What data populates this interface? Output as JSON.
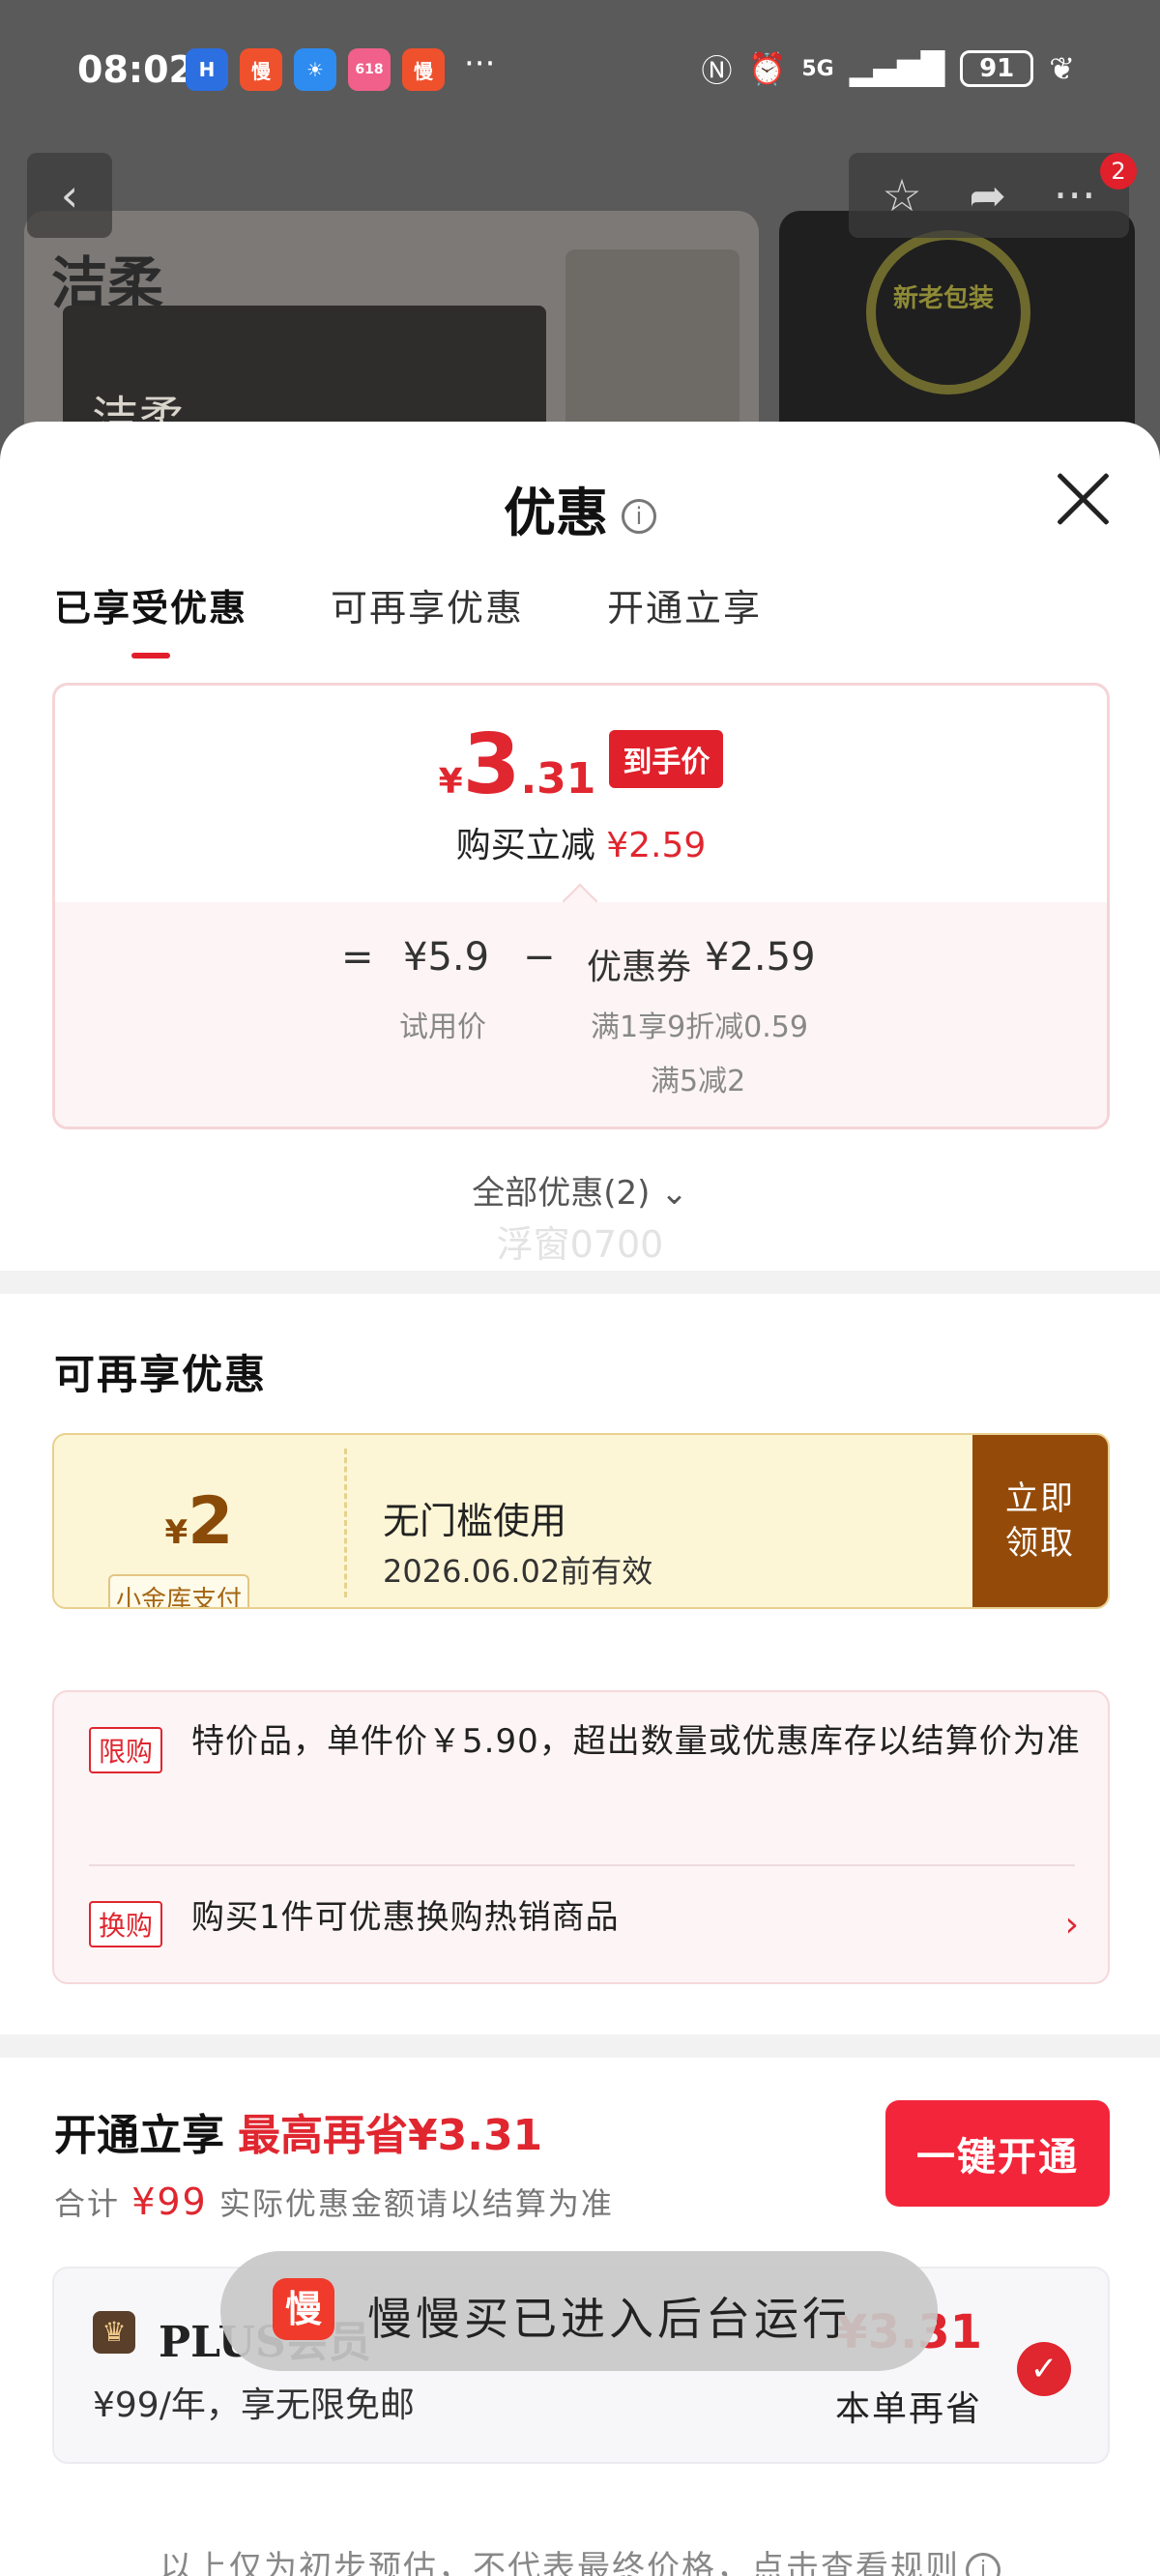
{
  "status_bar": {
    "time": "08:02",
    "apps": [
      {
        "icon": "hello-app-icon",
        "label": "H",
        "color": "#2c6fe0"
      },
      {
        "icon": "manmanmai-app-icon",
        "label": "慢",
        "color": "#f0512d"
      },
      {
        "icon": "weather-app-icon",
        "label": "☀",
        "color": "#2e8cf0"
      },
      {
        "icon": "618-app-icon",
        "label": "618",
        "color": "#f0608a"
      },
      {
        "icon": "manmanmai-app-icon-2",
        "label": "慢",
        "color": "#f0512d"
      }
    ],
    "more": "···",
    "signal": "5G",
    "battery": "91"
  },
  "background_page": {
    "brand_logo": "洁柔",
    "box_logo": "洁柔",
    "seal_text": "新老包装"
  },
  "sheet": {
    "title": "优惠",
    "tabs": [
      "已享受优惠",
      "可再享优惠",
      "开通立享"
    ],
    "active_tab": 0,
    "price_card": {
      "currency": "¥",
      "price_int": "3",
      "price_dec": ".31",
      "price_tag": "到手价",
      "sub_label": "购买立减",
      "sub_value": "¥2.59",
      "eq": "=",
      "trial_price": "¥5.9",
      "minus": "−",
      "coupon_label": "优惠券",
      "coupon_value": "¥2.59",
      "trial_price_label": "试用价",
      "coupon_detail_1": "满1享9折减0.59",
      "coupon_detail_2": "满5减2"
    },
    "all_offers": "全部优惠(2)",
    "watermark": "浮窗0700",
    "more_offers": {
      "title": "可再享优惠",
      "coupon": {
        "currency": "¥",
        "amount": "2",
        "chip": "小金库支付",
        "title": "无门槛使用",
        "valid": "2026.06.02前有效",
        "button": "立即领取"
      },
      "limit_tag": "限购",
      "limit_text": "特价品，单件价￥5.90，超出数量或优惠库存以结算价为准",
      "swap_tag": "换购",
      "swap_text": "购买1件可优惠换购热销商品"
    },
    "plus_section": {
      "title": "开通立享",
      "highlight": "最高再省¥3.31",
      "sub_prefix": "合计",
      "sub_amount": "¥99",
      "sub_suffix": "实际优惠金额请以结算为准",
      "open_button": "一键开通",
      "card_name": "PLUS会员",
      "card_desc": "¥99/年，享无限免邮",
      "card_save_value": "¥3.31",
      "card_save_label": "本单再省"
    },
    "toast": "慢慢买已进入后台运行",
    "footer_note": "以上仅为初步预估，不代表最终价格，点击查看规则"
  }
}
